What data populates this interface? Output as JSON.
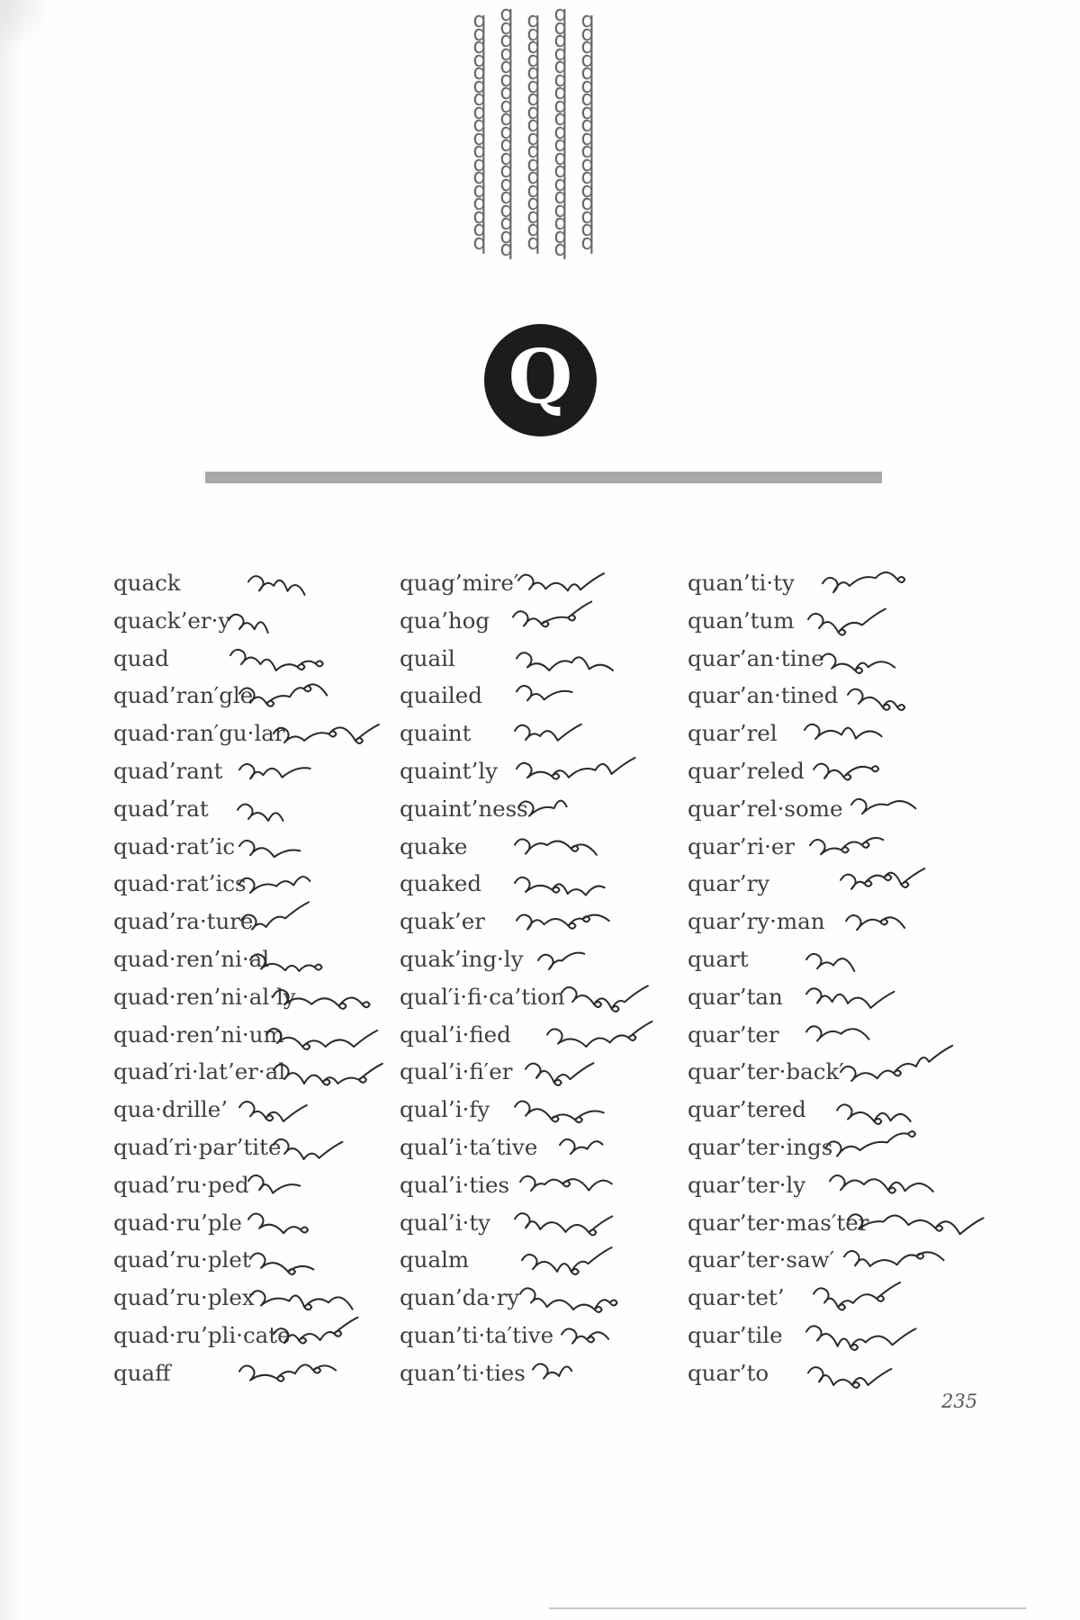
{
  "letter_badge": "Q",
  "pattern_glyph": "q",
  "page_number": "235",
  "columns": [
    {
      "entries": [
        {
          "word": "quack"
        },
        {
          "word": "quack’er·y"
        },
        {
          "word": "quad"
        },
        {
          "word": "quad’ran′gle"
        },
        {
          "word": "quad·ran′gu·lar"
        },
        {
          "word": "quad’rant"
        },
        {
          "word": "quad’rat"
        },
        {
          "word": "quad·rat’ic"
        },
        {
          "word": "quad·rat’ics"
        },
        {
          "word": "quad’ra·ture"
        },
        {
          "word": "quad·ren’ni·al"
        },
        {
          "word": "quad·ren’ni·al·ly"
        },
        {
          "word": "quad·ren’ni·um"
        },
        {
          "word": "quad′ri·lat’er·al"
        },
        {
          "word": "qua·drille’"
        },
        {
          "word": "quad′ri·par’tite"
        },
        {
          "word": "quad’ru·ped"
        },
        {
          "word": "quad·ru’ple"
        },
        {
          "word": "quad’ru·plet"
        },
        {
          "word": "quad’ru·plex"
        },
        {
          "word": "quad·ru’pli·cate"
        },
        {
          "word": "quaff"
        }
      ]
    },
    {
      "entries": [
        {
          "word": "quag’mire′"
        },
        {
          "word": "qua’hog"
        },
        {
          "word": "quail"
        },
        {
          "word": "quailed"
        },
        {
          "word": "quaint"
        },
        {
          "word": "quaint’ly"
        },
        {
          "word": "quaint’ness"
        },
        {
          "word": "quake"
        },
        {
          "word": "quaked"
        },
        {
          "word": "quak’er"
        },
        {
          "word": "quak’ing·ly"
        },
        {
          "word": "qual′i·fi·ca’tion"
        },
        {
          "word": "qual’i·fied"
        },
        {
          "word": "qual’i·fi′er"
        },
        {
          "word": "qual’i·fy"
        },
        {
          "word": "qual’i·ta′tive"
        },
        {
          "word": "qual’i·ties"
        },
        {
          "word": "qual’i·ty"
        },
        {
          "word": "qualm"
        },
        {
          "word": "quan’da·ry"
        },
        {
          "word": "quan’ti·ta′tive"
        },
        {
          "word": "quan’ti·ties"
        }
      ]
    },
    {
      "entries": [
        {
          "word": "quan’ti·ty"
        },
        {
          "word": "quan’tum"
        },
        {
          "word": "quar’an·tine"
        },
        {
          "word": "quar’an·tined"
        },
        {
          "word": "quar’rel"
        },
        {
          "word": "quar’reled"
        },
        {
          "word": "quar’rel·some"
        },
        {
          "word": "quar’ri·er"
        },
        {
          "word": "quar’ry"
        },
        {
          "word": "quar’ry·man"
        },
        {
          "word": "quart"
        },
        {
          "word": "quar’tan"
        },
        {
          "word": "quar’ter"
        },
        {
          "word": "quar’ter·back′"
        },
        {
          "word": "quar’tered"
        },
        {
          "word": "quar’ter·ings"
        },
        {
          "word": "quar’ter·ly"
        },
        {
          "word": "quar’ter·mas′ter"
        },
        {
          "word": "quar’ter·saw′"
        },
        {
          "word": "quar·tet’"
        },
        {
          "word": "quar’tile"
        },
        {
          "word": "quar’to"
        }
      ]
    }
  ]
}
